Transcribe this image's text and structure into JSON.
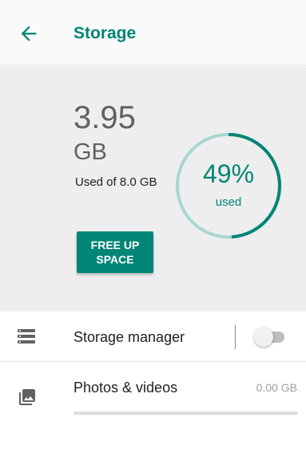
{
  "header": {
    "title": "Storage",
    "back_icon": "arrow-back-icon"
  },
  "summary": {
    "used_value": "3.95",
    "used_unit": "GB",
    "used_of": "Used of 8.0 GB",
    "free_up_button": "FREE UP SPACE",
    "percent_text": "49%",
    "percent_label": "used",
    "used_fraction": 0.49
  },
  "settings": {
    "storage_manager": {
      "label": "Storage manager",
      "icon": "storage-manager-icon",
      "enabled": false
    },
    "photos_videos": {
      "label": "Photos & videos",
      "icon": "photo-library-icon",
      "size": "0.00 GB",
      "used_fraction": 0.0
    }
  },
  "colors": {
    "accent": "#008577",
    "ring_track": "#a9d6d1",
    "background_summary": "#eeeeee"
  }
}
